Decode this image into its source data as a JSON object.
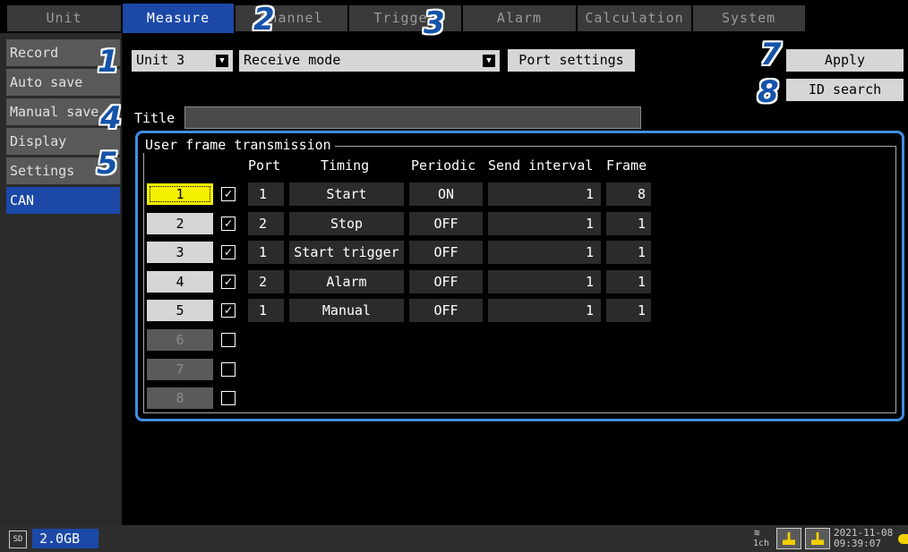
{
  "tabs": [
    {
      "label": "Unit",
      "active": false
    },
    {
      "label": "Measure",
      "active": true
    },
    {
      "label": "Channel",
      "active": false
    },
    {
      "label": "Trigger",
      "active": false
    },
    {
      "label": "Alarm",
      "active": false
    },
    {
      "label": "Calculation",
      "active": false
    },
    {
      "label": "System",
      "active": false
    }
  ],
  "sidebar": [
    {
      "label": "Record"
    },
    {
      "label": "Auto save"
    },
    {
      "label": "Manual save"
    },
    {
      "label": "Display"
    },
    {
      "label": "Settings"
    },
    {
      "label": "CAN",
      "active": true
    }
  ],
  "controls": {
    "unit_select": "Unit 3",
    "mode_select": "Receive mode",
    "port_settings": "Port settings",
    "apply": "Apply",
    "id_search": "ID search",
    "title_label": "Title",
    "title_value": ""
  },
  "callouts": [
    "1",
    "2",
    "3",
    "4",
    "5",
    "7",
    "8"
  ],
  "frame": {
    "legend": "User frame transmission",
    "headers": {
      "port": "Port",
      "timing": "Timing",
      "periodic": "Periodic",
      "send_interval": "Send interval",
      "frame": "Frame"
    },
    "rows": [
      {
        "num": "1",
        "checked": true,
        "enabled": true,
        "selected": true,
        "port": "1",
        "timing": "Start",
        "periodic": "ON",
        "interval": "1",
        "frame": "8"
      },
      {
        "num": "2",
        "checked": true,
        "enabled": true,
        "port": "2",
        "timing": "Stop",
        "periodic": "OFF",
        "interval": "1",
        "frame": "1"
      },
      {
        "num": "3",
        "checked": true,
        "enabled": true,
        "port": "1",
        "timing": "Start trigger",
        "periodic": "OFF",
        "interval": "1",
        "frame": "1"
      },
      {
        "num": "4",
        "checked": true,
        "enabled": true,
        "port": "2",
        "timing": "Alarm",
        "periodic": "OFF",
        "interval": "1",
        "frame": "1"
      },
      {
        "num": "5",
        "checked": true,
        "enabled": true,
        "port": "1",
        "timing": "Manual",
        "periodic": "OFF",
        "interval": "1",
        "frame": "1"
      },
      {
        "num": "6",
        "checked": false,
        "enabled": false
      },
      {
        "num": "7",
        "checked": false,
        "enabled": false
      },
      {
        "num": "8",
        "checked": false,
        "enabled": false
      }
    ]
  },
  "status": {
    "sd_icon": "SD",
    "capacity": "2.0GB",
    "channel_label": "1ch",
    "date": "2021-11-08",
    "time": "09:39:07"
  },
  "colors": {
    "accent": "#1c49a8",
    "callout": "#1453a8",
    "selected": "#f5f000",
    "frame_border": "#3f8fe0"
  }
}
